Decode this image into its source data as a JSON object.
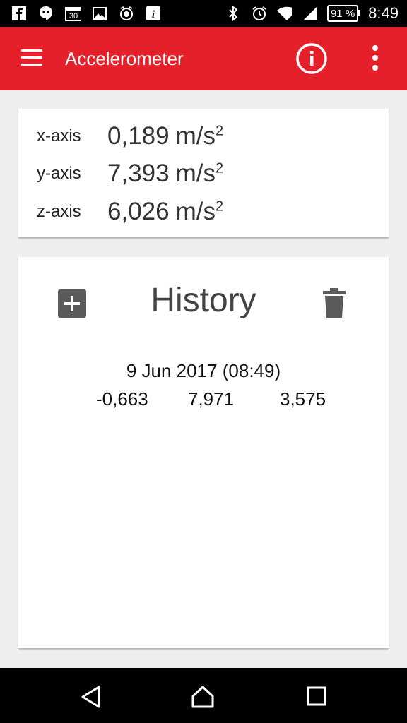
{
  "status_bar": {
    "icons": [
      "facebook-icon",
      "hangouts-icon",
      "calendar-icon",
      "gallery-icon",
      "alarm-app-icon",
      "info-app-icon"
    ],
    "calendar_day": "30",
    "battery": "91 %",
    "time": "8:49"
  },
  "app_bar": {
    "title": "Accelerometer"
  },
  "readings": [
    {
      "label": "x-axis",
      "value": "0,189",
      "unit": "m/s",
      "exponent": "2"
    },
    {
      "label": "y-axis",
      "value": "7,393",
      "unit": "m/s",
      "exponent": "2"
    },
    {
      "label": "z-axis",
      "value": "6,026",
      "unit": "m/s",
      "exponent": "2"
    }
  ],
  "history": {
    "title": "History",
    "entries": [
      {
        "date": "9 Jun 2017 (08:49)",
        "x": "-0,663",
        "y": "7,971",
        "z": "3,575"
      }
    ]
  },
  "colors": {
    "accent": "#e5202a",
    "background": "#eeeeee",
    "card": "#ffffff"
  }
}
